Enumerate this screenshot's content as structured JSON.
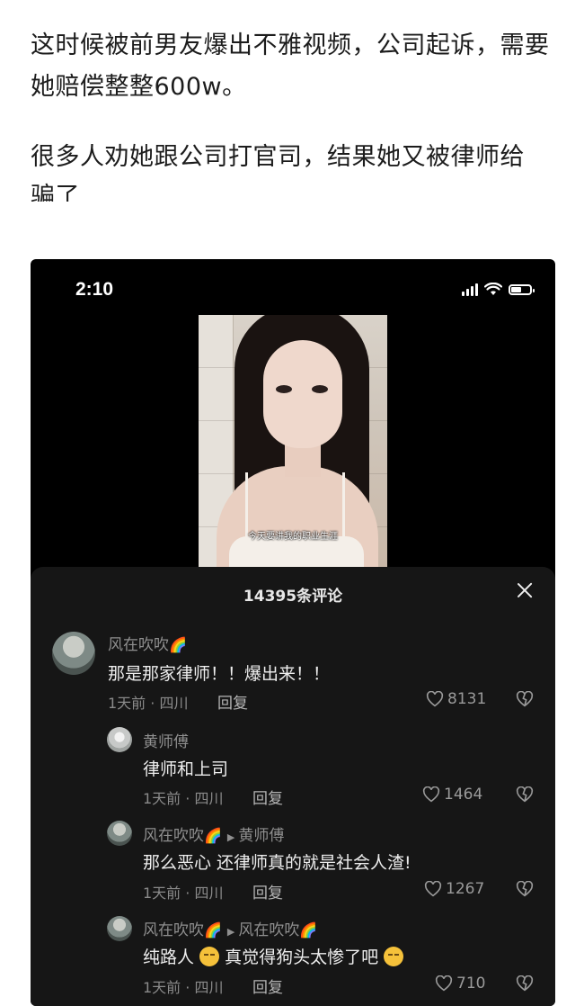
{
  "article": {
    "paragraph1": "这时候被前男友爆出不雅视频，公司起诉，需要她赔偿整整600w。",
    "paragraph2": "很多人劝她跟公司打官司，结果她又被律师给",
    "paragraph3_partial": "骗了"
  },
  "phone": {
    "status_time": "2:10",
    "battery_level": 0.55,
    "video_caption": "今天要讲我的职业生涯",
    "comments_sheet": {
      "title": "14395条评论",
      "comments": [
        {
          "user": "风在吹吹",
          "user_emoji": "🌈",
          "text": "那是那家律师！！爆出来！！",
          "meta": "1天前 · 四川",
          "reply_label": "回复",
          "likes": "8131"
        },
        {
          "user": "黄师傅",
          "text": "律师和上司",
          "meta": "1天前 · 四川",
          "reply_label": "回复",
          "likes": "1464"
        },
        {
          "user": "风在吹吹",
          "user_emoji": "🌈",
          "reply_to": "黄师傅",
          "text": "那么恶心 还律师真的就是社会人渣!",
          "meta": "1天前 · 四川",
          "reply_label": "回复",
          "likes": "1267"
        },
        {
          "user": "风在吹吹",
          "user_emoji": "🌈",
          "reply_to": "风在吹吹",
          "reply_to_emoji": "🌈",
          "text_before_emoji": "纯路人",
          "text_after_emoji": "真觉得狗头太惨了吧",
          "meta": "1天前 · 四川",
          "reply_label": "回复",
          "likes": "710"
        }
      ]
    }
  },
  "colors": {
    "sheet_bg": "#161616",
    "name_gray": "#8f8f8f",
    "text_white": "#eeeeee"
  }
}
